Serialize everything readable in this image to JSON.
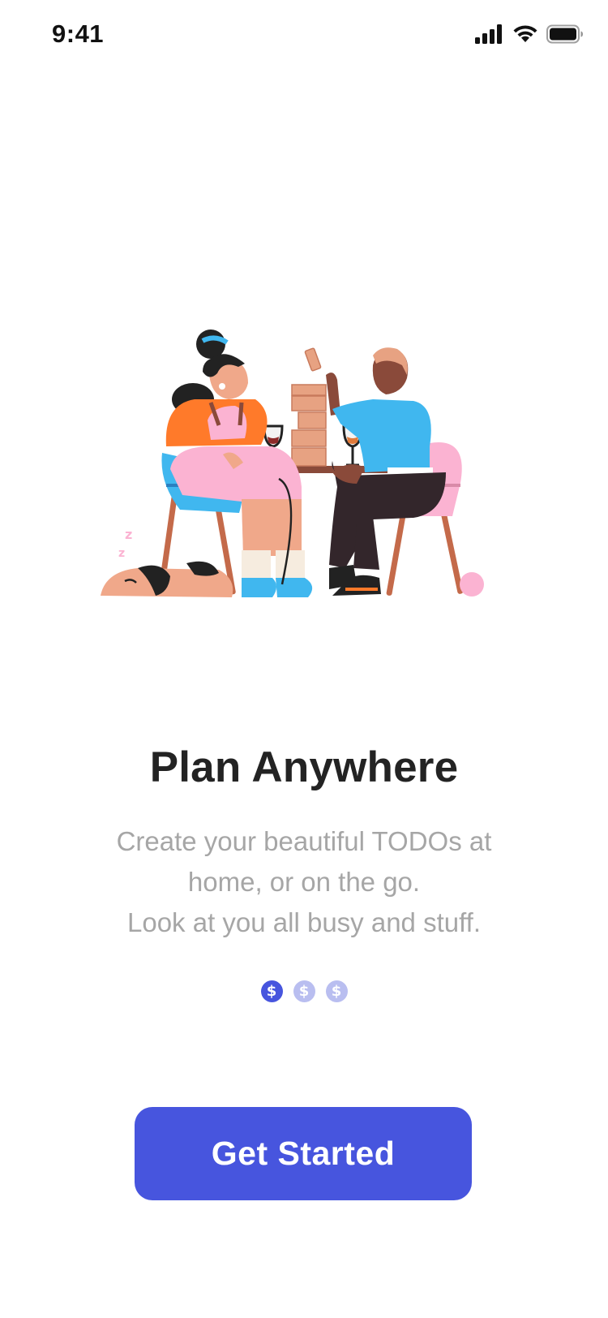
{
  "status_bar": {
    "time": "9:41",
    "icons": [
      "cellular-signal-icon",
      "wifi-icon",
      "battery-icon"
    ]
  },
  "illustration": {
    "name": "friends-playing-jenga-illustration"
  },
  "onboarding": {
    "title": "Plan Anywhere",
    "subtitle_lines": [
      "Create your beautiful TODOs at",
      "home, or on the go.",
      "Look at you all busy and stuff."
    ],
    "pager": {
      "current_page": 1,
      "page_count": 3,
      "dot_glyph": "$"
    },
    "cta_label": "Get Started"
  },
  "colors": {
    "accent": "#4755de",
    "accent_light": "#b9bef0",
    "title": "#232323",
    "subtitle": "#a6a6a6",
    "background": "#ffffff"
  }
}
